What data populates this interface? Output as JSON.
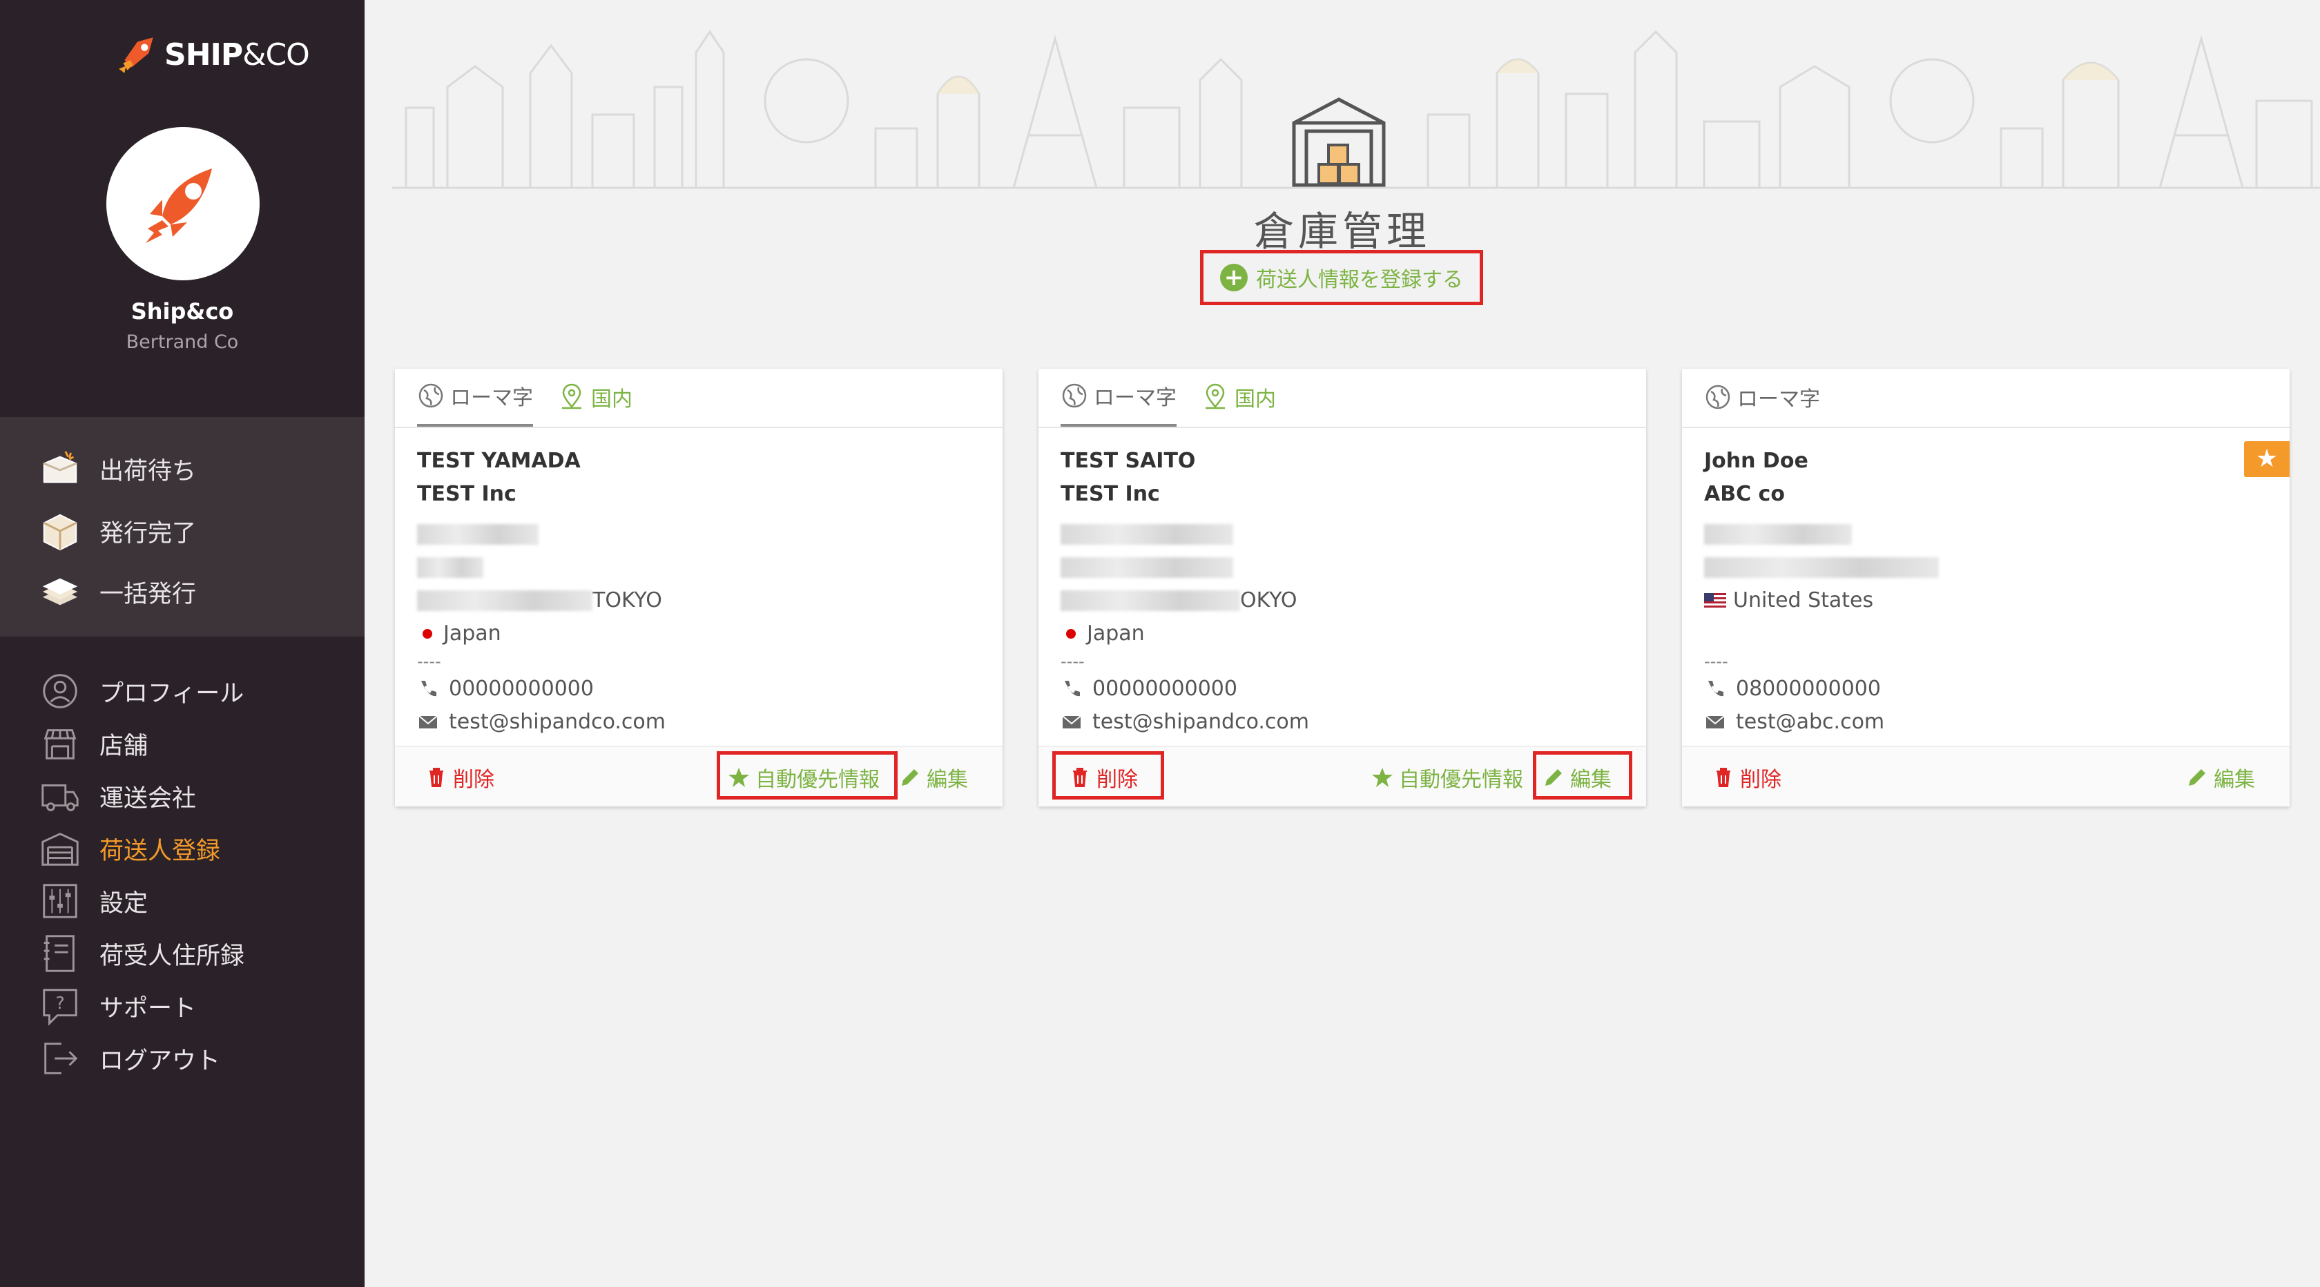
{
  "brand": {
    "logo_text": "SHIP",
    "logo_amp": "&",
    "logo_co": "CO"
  },
  "account": {
    "name": "Ship&co",
    "company": "Bertrand Co"
  },
  "shipping_nav": [
    {
      "label": "出荷待ち",
      "icon": "box-open-icon"
    },
    {
      "label": "発行完了",
      "icon": "box-icon"
    },
    {
      "label": "一括発行",
      "icon": "box-stack-icon"
    }
  ],
  "main_nav": [
    {
      "label": "プロフィール",
      "icon": "user-icon"
    },
    {
      "label": "店舗",
      "icon": "store-icon"
    },
    {
      "label": "運送会社",
      "icon": "truck-icon"
    },
    {
      "label": "荷送人登録",
      "icon": "warehouse-icon",
      "active": true
    },
    {
      "label": "設定",
      "icon": "sliders-icon"
    },
    {
      "label": "荷受人住所録",
      "icon": "address-book-icon"
    },
    {
      "label": "サポート",
      "icon": "help-icon"
    },
    {
      "label": "ログアウト",
      "icon": "logout-icon"
    }
  ],
  "page": {
    "title": "倉庫管理",
    "register_label": "荷送人情報を登録する"
  },
  "cards": [
    {
      "tabs": {
        "roman": "ローマ字",
        "domestic": "国内"
      },
      "name": "TEST YAMADA",
      "company": "TEST Inc",
      "city": "TOKYO",
      "country": "Japan",
      "separator": "----",
      "phone": "00000000000",
      "email": "test@shipandco.com",
      "actions": {
        "delete": "削除",
        "auto": "自動優先情報",
        "edit": "編集"
      }
    },
    {
      "tabs": {
        "roman": "ローマ字",
        "domestic": "国内"
      },
      "name": "TEST SAITO",
      "company": "TEST Inc",
      "city": "OKYO",
      "country": "Japan",
      "separator": "----",
      "phone": "00000000000",
      "email": "test@shipandco.com",
      "actions": {
        "delete": "削除",
        "auto": "自動優先情報",
        "edit": "編集"
      }
    },
    {
      "tabs": {
        "roman": "ローマ字"
      },
      "default_badge": "★",
      "name": "John Doe",
      "company": "ABC co",
      "country": "United States",
      "separator": "----",
      "phone": "08000000000",
      "email": "test@abc.com",
      "actions": {
        "delete": "削除",
        "edit": "編集"
      }
    }
  ],
  "colors": {
    "sidebar": "#2a2228",
    "accent": "#f39a2a",
    "green": "#7cb342",
    "danger": "#e02525"
  }
}
